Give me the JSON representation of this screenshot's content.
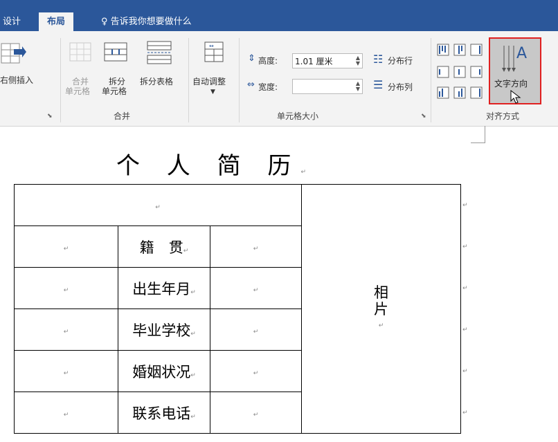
{
  "tabs": {
    "design": "设计",
    "layout": "布局",
    "tell_me": "告诉我你想要做什么"
  },
  "ribbon": {
    "insert_right": "右侧插入",
    "merge_cells_line1": "合并",
    "merge_cells_line2": "单元格",
    "split_cells_line1": "拆分",
    "split_cells_line2": "单元格",
    "split_table": "拆分表格",
    "autofit": "自动调整",
    "merge_group": "合并",
    "height_label": "高度:",
    "height_value": "1.01 厘米",
    "width_label": "宽度:",
    "width_value": "",
    "distribute_rows": "分布行",
    "distribute_cols": "分布列",
    "cell_size_group": "单元格大小",
    "text_direction": "文字方向",
    "align_group": "对齐方式"
  },
  "document": {
    "title": "个 人 简 历",
    "paragraph_mark": "↵",
    "fields": [
      "籍　贯",
      "出生年月",
      "毕业学校",
      "婚姻状况",
      "联系电话"
    ],
    "photo_line1": "相",
    "photo_line2": "片"
  },
  "colors": {
    "title_bar": "#2b579a",
    "highlight": "#e02020"
  }
}
